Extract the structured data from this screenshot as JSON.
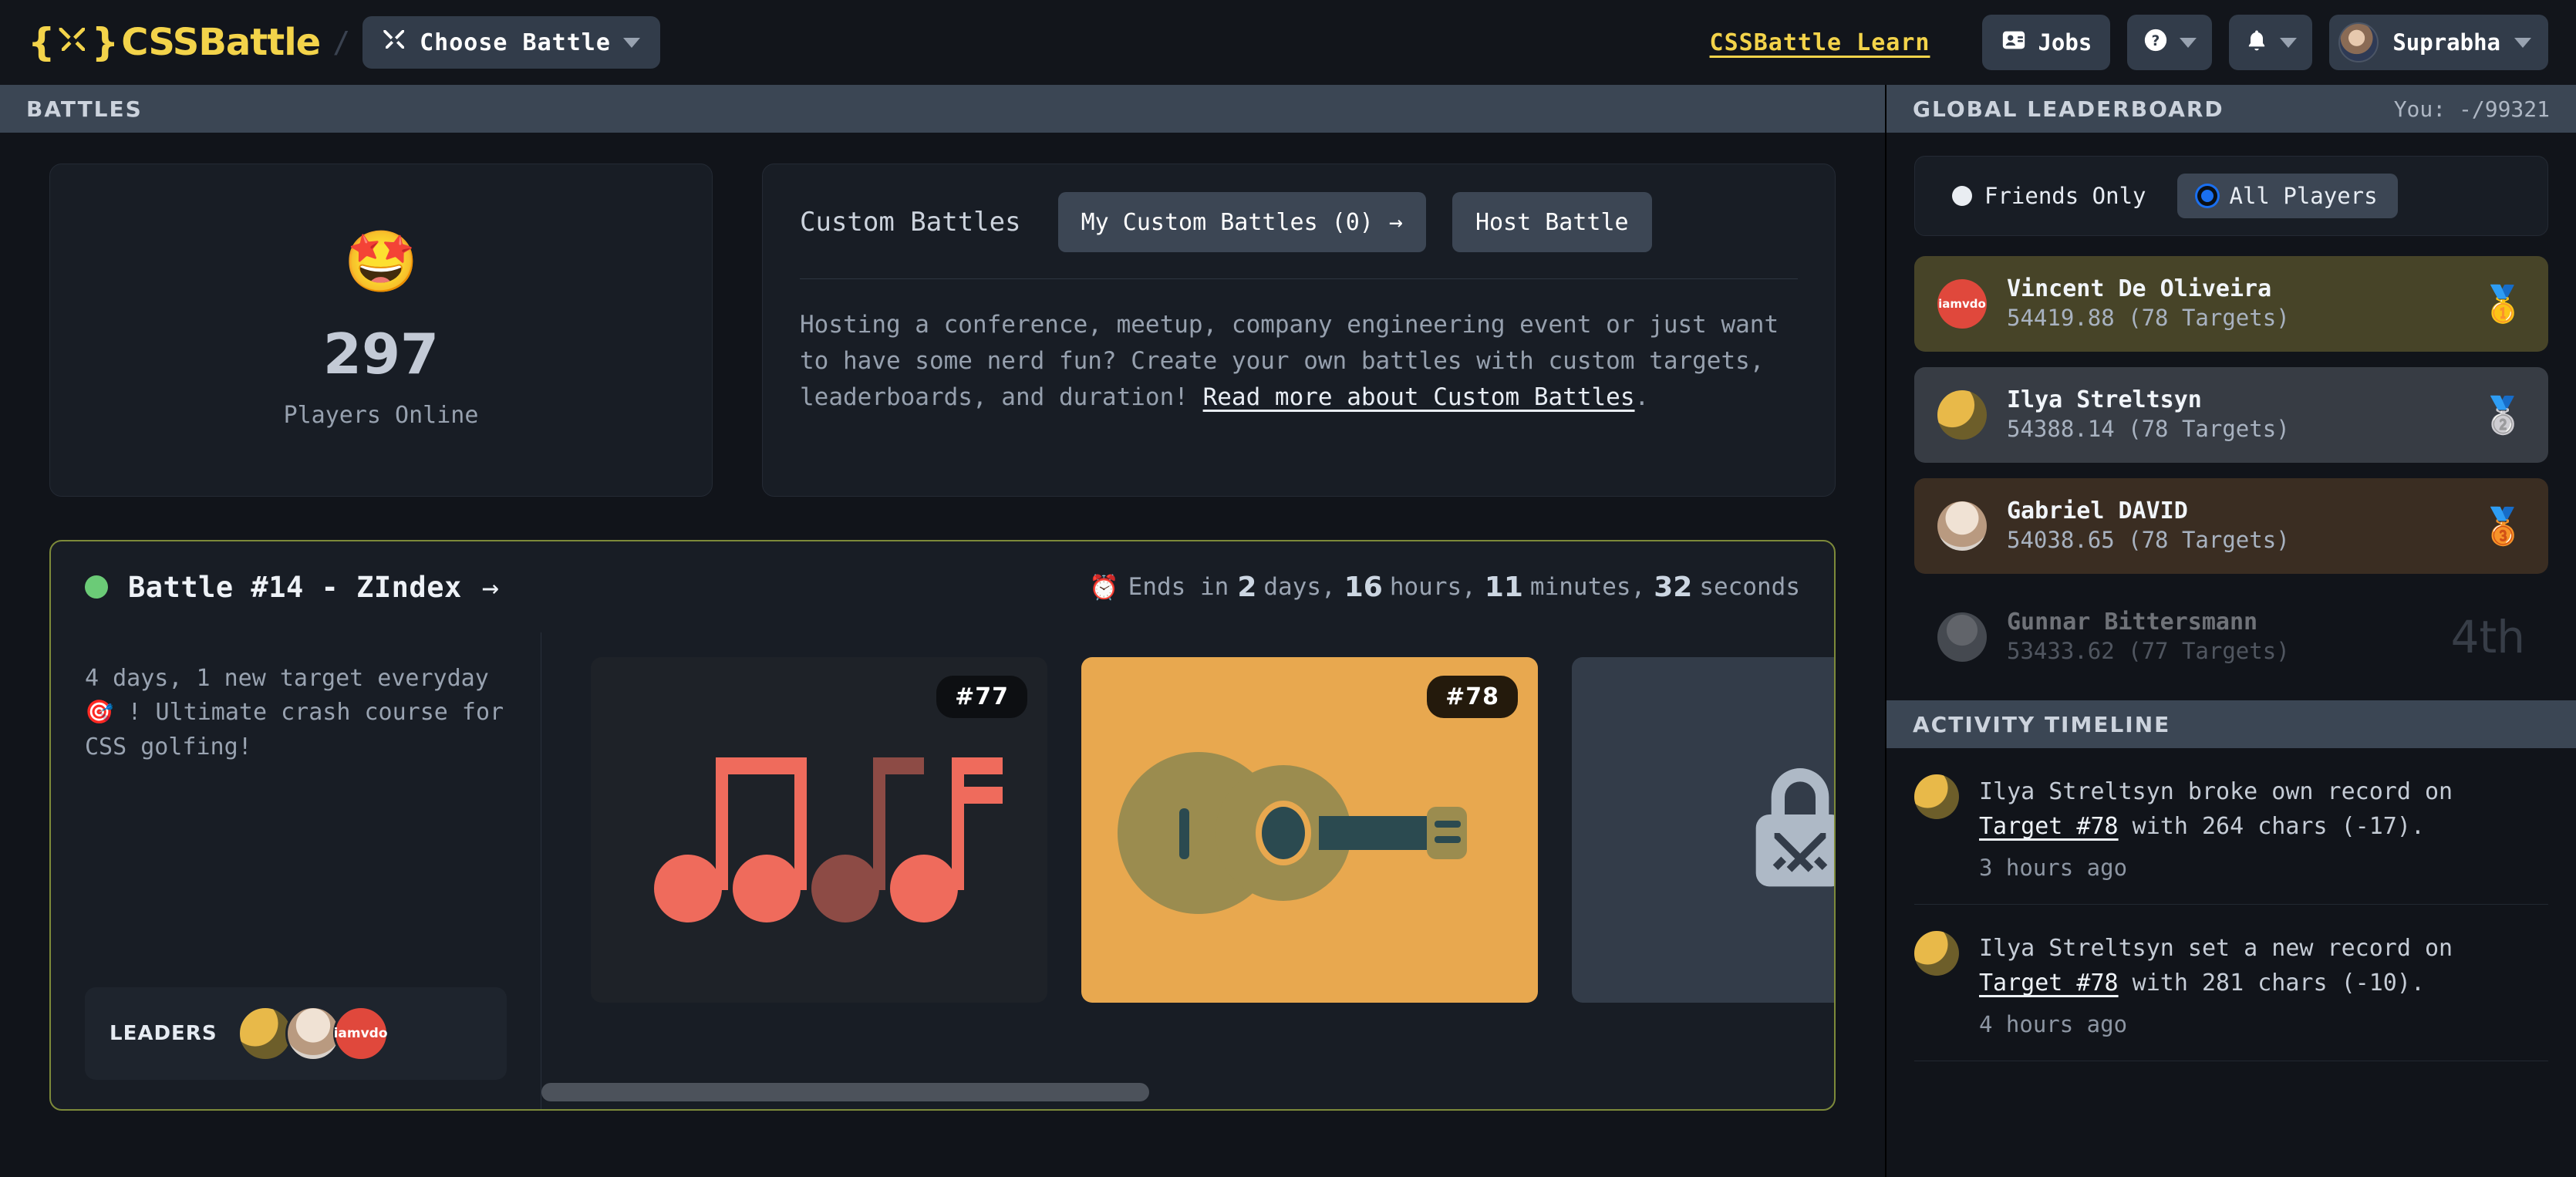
{
  "header": {
    "logo_text": "CSSBattle",
    "logo_brace_left": "{",
    "logo_brace_right": "}",
    "logo_icon": "crossed-swords-icon",
    "separator": "/",
    "choose_battle_label": "Choose Battle",
    "learn_link": "CSSBattle Learn",
    "jobs_label": "Jobs",
    "help_label": "?",
    "bell_label": "🔔",
    "user_name": "Suprabha",
    "accent_yellow": "#f3d34a",
    "button_bg": "#323c4a"
  },
  "battles_bar": {
    "title": "BATTLES"
  },
  "online_card": {
    "emoji": "🤩",
    "count": "297",
    "label": "Players Online"
  },
  "custom_battles": {
    "title": "Custom Battles",
    "my_battles_label": "My Custom Battles (0)",
    "my_battles_arrow": "→",
    "host_battle_label": "Host Battle",
    "description_part1": "Hosting a conference, meetup, company engineering event or just want to have some nerd fun? Create your own battles with custom targets, leaderboards, and duration! ",
    "description_link": "Read more about Custom Battles",
    "description_part2": "."
  },
  "battle": {
    "status": "live",
    "name": "Battle #14 - ZIndex",
    "arrow": "→",
    "countdown": {
      "clock_icon": "⏰",
      "prefix": "Ends in",
      "days_value": "2",
      "days_label": "days,",
      "hours_value": "16",
      "hours_label": "hours,",
      "minutes_value": "11",
      "minutes_label": "minutes,",
      "seconds_value": "32",
      "seconds_label": "seconds"
    },
    "description": "4 days, 1 new target everyday 🎯 ! Ultimate crash course for CSS golfing!",
    "leaders_label": "LEADERS",
    "leaders": [
      {
        "name": "Ilya Streltsyn",
        "avatar": "desk-photo"
      },
      {
        "name": "Gabriel DAVID",
        "avatar": "face-photo"
      },
      {
        "name": "Vincent De Oliveira",
        "avatar": "iamvdo-logo",
        "initials": "iamvdo"
      }
    ],
    "targets": [
      {
        "badge": "#77",
        "kind": "music-notes",
        "bg": "#1e2228",
        "fg": "#ef6b5c",
        "fg_dim": "#8d4b45",
        "locked": false
      },
      {
        "badge": "#78",
        "kind": "guitar",
        "bg": "#e8a84f",
        "body": "#9b8c4f",
        "neck": "#2b4a50",
        "locked": false
      },
      {
        "badge": "",
        "kind": "locked",
        "bg": "#333c49",
        "locked": true
      }
    ],
    "border_color": "#7d8a3a"
  },
  "leaderboard": {
    "title": "GLOBAL LEADERBOARD",
    "you_label": "You: -/99321",
    "filters": [
      {
        "label": "Friends Only",
        "selected": false
      },
      {
        "label": "All Players",
        "selected": true
      }
    ],
    "rows": [
      {
        "name": "Vincent De Oliveira",
        "score": "54419.88 (78 Targets)",
        "medal": "🥇",
        "rank_text": "",
        "avatar": "iamvdo-logo",
        "initials": "iamvdo"
      },
      {
        "name": "Ilya Streltsyn",
        "score": "54388.14 (78 Targets)",
        "medal": "🥈",
        "rank_text": "",
        "avatar": "desk-photo"
      },
      {
        "name": "Gabriel DAVID",
        "score": "54038.65 (78 Targets)",
        "medal": "🥉",
        "rank_text": "",
        "avatar": "face-photo"
      },
      {
        "name": "Gunnar Bittersmann",
        "score": "53433.62 (77 Targets)",
        "medal": "",
        "rank_text": "4th",
        "avatar": "gray-photo"
      }
    ]
  },
  "activity": {
    "title": "ACTIVITY TIMELINE",
    "items": [
      {
        "prefix": "Ilya Streltsyn broke own record on ",
        "link": "Target #78",
        "suffix": " with 264 chars (-17).",
        "time": "3 hours ago"
      },
      {
        "prefix": "Ilya Streltsyn set a new record on ",
        "link": "Target #78",
        "suffix": " with 281 chars (-10).",
        "time": "4 hours ago"
      }
    ]
  }
}
